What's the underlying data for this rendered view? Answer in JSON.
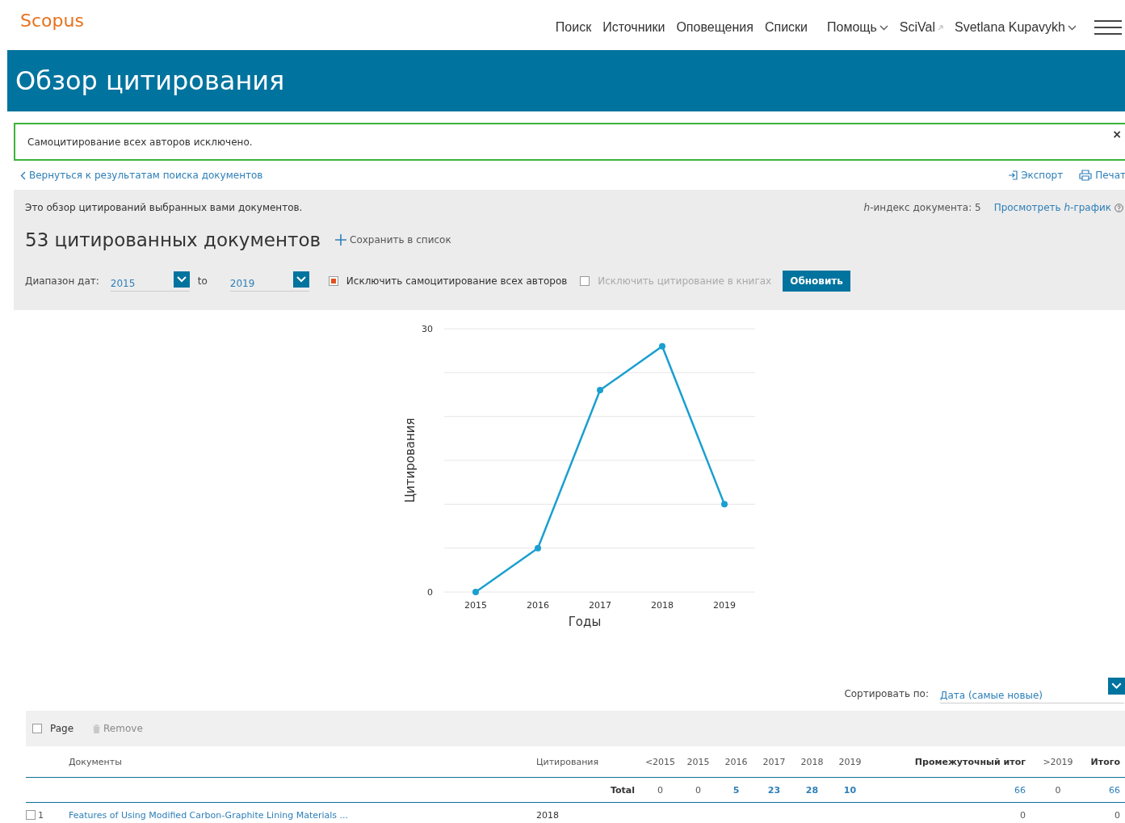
{
  "header": {
    "logo": "Scopus",
    "nav": [
      {
        "label": "Поиск",
        "kind": "plain"
      },
      {
        "label": "Источники",
        "kind": "plain"
      },
      {
        "label": "Оповещения",
        "kind": "plain"
      },
      {
        "label": "Списки",
        "kind": "plain"
      },
      {
        "label": "Помощь",
        "kind": "menu"
      },
      {
        "label": "SciVal",
        "kind": "external"
      },
      {
        "label": "Svetlana Kupavykh",
        "kind": "menu"
      }
    ]
  },
  "banner": {
    "title": "Обзор цитирования"
  },
  "alert": {
    "message": "Самоцитирование всех авторов исключено.",
    "close": "×"
  },
  "actions": {
    "back": "Вернуться к результатам поиска документов",
    "export": "Экспорт",
    "print": "Печат"
  },
  "overview": {
    "intro": "Это обзор цитирований выбранных вами документов.",
    "h_index": "*h*-индекс документа: 5",
    "h_graph": "Просмотреть *h*-график",
    "heading": "53 цитированных документов",
    "save": "Сохранить в список"
  },
  "filters": {
    "range_label": "Диапазон дат:",
    "from": "2015",
    "to_label": "to",
    "to": "2019",
    "options": [
      {
        "label": "Исключить самоцитирование всех авторов",
        "checked": true
      },
      {
        "label": "Исключить цитирование в книгах",
        "checked": false
      }
    ],
    "update": "Обновить"
  },
  "chart": {
    "chart_data": {
      "type": "line",
      "xlabel": "Годы",
      "ylabel": "Цитирования",
      "categories": [
        "2015",
        "2016",
        "2017",
        "2018",
        "2019"
      ],
      "series": [
        {
          "color": "#1a9fd0",
          "marker": true,
          "values": [
            0,
            5,
            23,
            28,
            10
          ]
        }
      ],
      "ylim": [
        0,
        30
      ],
      "yticks": [
        0,
        30
      ]
    }
  },
  "sort": {
    "label": "Сортировать по:",
    "value": "Дата (самые новые)"
  },
  "toolbar": {
    "page": "Page",
    "page_checked": false,
    "remove": "Remove"
  },
  "table": {
    "columns": [
      "Документы",
      "Цитирования",
      "<2015",
      "2015",
      "2016",
      "2017",
      "2018",
      "2019",
      "Промежуточный итог",
      ">2019",
      "Итого"
    ],
    "total": {
      "label": "Total",
      "cells": [
        {
          "text": "0",
          "link": false
        },
        {
          "text": "0",
          "link": false
        },
        {
          "text": "5",
          "link": true
        },
        {
          "text": "23",
          "link": true
        },
        {
          "text": "28",
          "link": true
        },
        {
          "text": "10",
          "link": true
        },
        {
          "text": "66",
          "link": true
        },
        {
          "text": "0",
          "link": false
        },
        {
          "text": "66",
          "link": true
        }
      ]
    },
    "rows": [
      {
        "index": "1",
        "checked": false,
        "title": "Features of Using Modified Carbon-Graphite Lining Materials ...",
        "year": "2018",
        "subtotal": "0",
        "total": "0"
      }
    ]
  }
}
